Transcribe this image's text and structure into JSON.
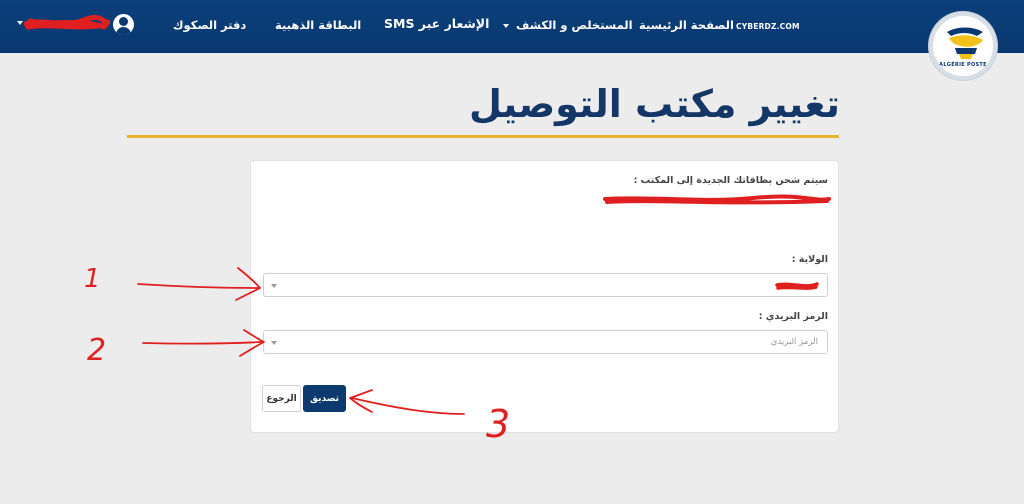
{
  "header": {
    "brand_link": "CYBERDZ.COM",
    "nav": {
      "home": "الصفحة الرئيسية",
      "statements": "المستخلص و الكشف",
      "sms": "الإشعار عبر SMS",
      "gold_card": "البطاقة الذهبية",
      "checkbook": "دفتر الصكوك"
    },
    "logo_text": "ALGÉRIE POSTE"
  },
  "page": {
    "title": "تغيير مكتب التوصيل"
  },
  "form": {
    "notice_label": "سيتم شحن بطاقاتك الجديدة إلى المكتب :",
    "wilaya_label": "الولاية :",
    "postal_label": "الرمز البريدي :",
    "postal_placeholder": "الرمز البريدي",
    "confirm_button": "تصديق",
    "back_button": "الرجوع"
  },
  "annotations": {
    "one": "1",
    "two": "2",
    "three": "3"
  },
  "colors": {
    "header_bg": "#0a3870",
    "accent_yellow": "#e7b22c",
    "title_blue": "#143768",
    "confirm_bg": "#0d3a6e",
    "annotation_red": "#e02020"
  }
}
